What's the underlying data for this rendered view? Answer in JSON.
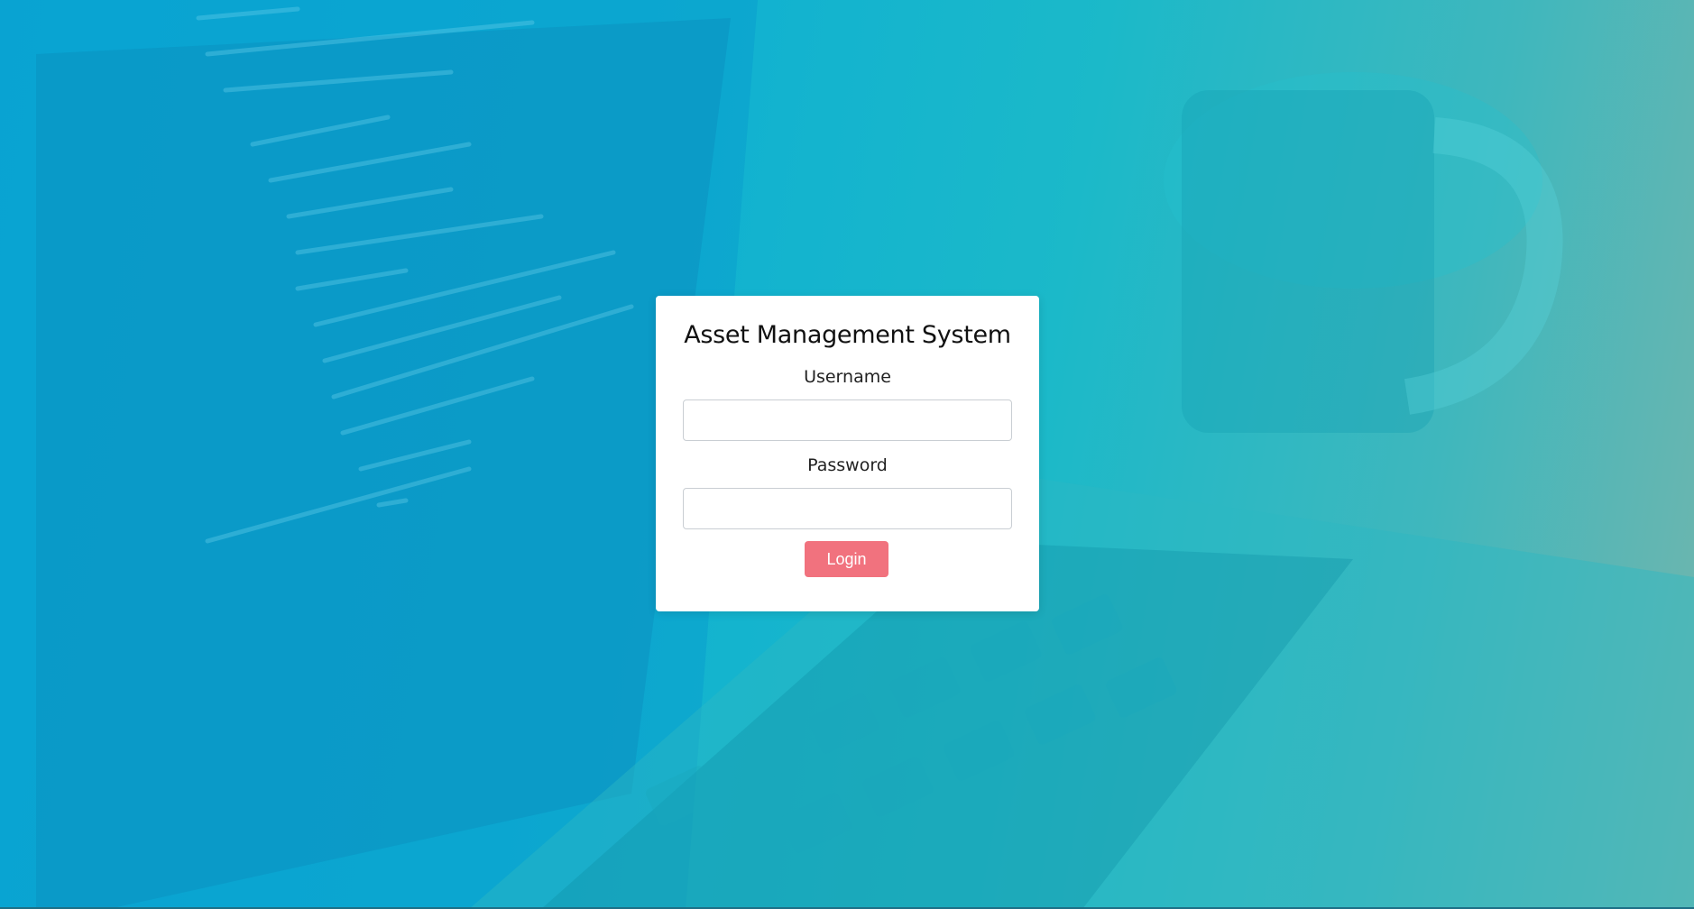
{
  "app": {
    "title": "Asset Management System"
  },
  "form": {
    "username_label": "Username",
    "username_value": "",
    "password_label": "Password",
    "password_value": "",
    "login_label": "Login"
  },
  "colors": {
    "background_start": "#0aa9d8",
    "background_end": "#72b6ad",
    "card": "#ffffff",
    "login_button": "#f1727e"
  },
  "background_image": "laptop-code-coffee-mug-photo"
}
